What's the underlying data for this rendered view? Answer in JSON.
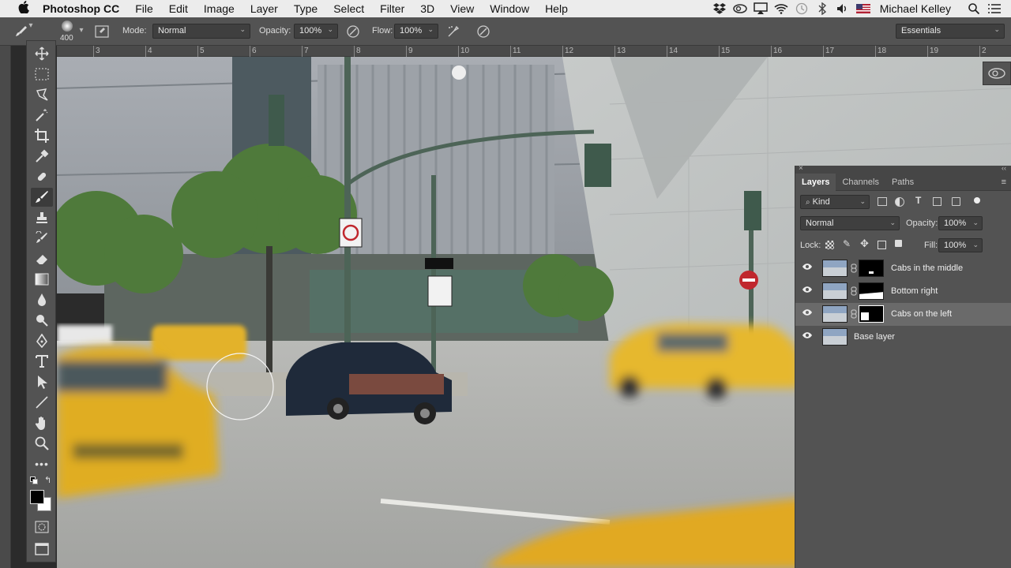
{
  "menubar": {
    "app": "Photoshop CC",
    "items": [
      "File",
      "Edit",
      "Image",
      "Layer",
      "Type",
      "Select",
      "Filter",
      "3D",
      "View",
      "Window",
      "Help"
    ],
    "user": "Michael Kelley",
    "status_icons": [
      "dropbox-icon",
      "creative-cloud-icon",
      "airplay-icon",
      "wifi-icon",
      "time-machine-icon",
      "bluetooth-icon",
      "volume-icon",
      "flag-icon",
      "search-icon",
      "list-icon"
    ]
  },
  "options": {
    "brush_size": "400",
    "mode_label": "Mode:",
    "mode_value": "Normal",
    "opacity_label": "Opacity:",
    "opacity_value": "100%",
    "flow_label": "Flow:",
    "flow_value": "100%",
    "workspace": "Essentials"
  },
  "ruler": {
    "ticks": [
      "3",
      "4",
      "5",
      "6",
      "7",
      "8",
      "9",
      "10",
      "11",
      "12",
      "13",
      "14",
      "15",
      "16",
      "17",
      "18",
      "19",
      "2"
    ]
  },
  "tools": [
    "move",
    "marquee",
    "lasso",
    "magic-wand",
    "crop",
    "eyedropper",
    "healing",
    "brush",
    "stamp",
    "history-brush",
    "eraser",
    "gradient",
    "blur",
    "dodge",
    "pen",
    "type",
    "path-select",
    "line",
    "hand",
    "zoom",
    "more"
  ],
  "layers_panel": {
    "tabs": [
      "Layers",
      "Channels",
      "Paths"
    ],
    "active_tab": "Layers",
    "filter_kind": "Kind",
    "blend_mode": "Normal",
    "opacity_label": "Opacity:",
    "opacity_value": "100%",
    "lock_label": "Lock:",
    "fill_label": "Fill:",
    "fill_value": "100%",
    "layers": [
      {
        "name": "Cabs in the middle",
        "has_mask": true,
        "selected": false
      },
      {
        "name": "Bottom right",
        "has_mask": true,
        "selected": false
      },
      {
        "name": "Cabs on the left",
        "has_mask": true,
        "selected": true
      },
      {
        "name": "Base layer",
        "has_mask": false,
        "selected": false
      }
    ]
  },
  "colors": {
    "taxi_yellow": "#e8b42a",
    "building_gray": "#8e949c",
    "panel_bg": "#535353"
  }
}
